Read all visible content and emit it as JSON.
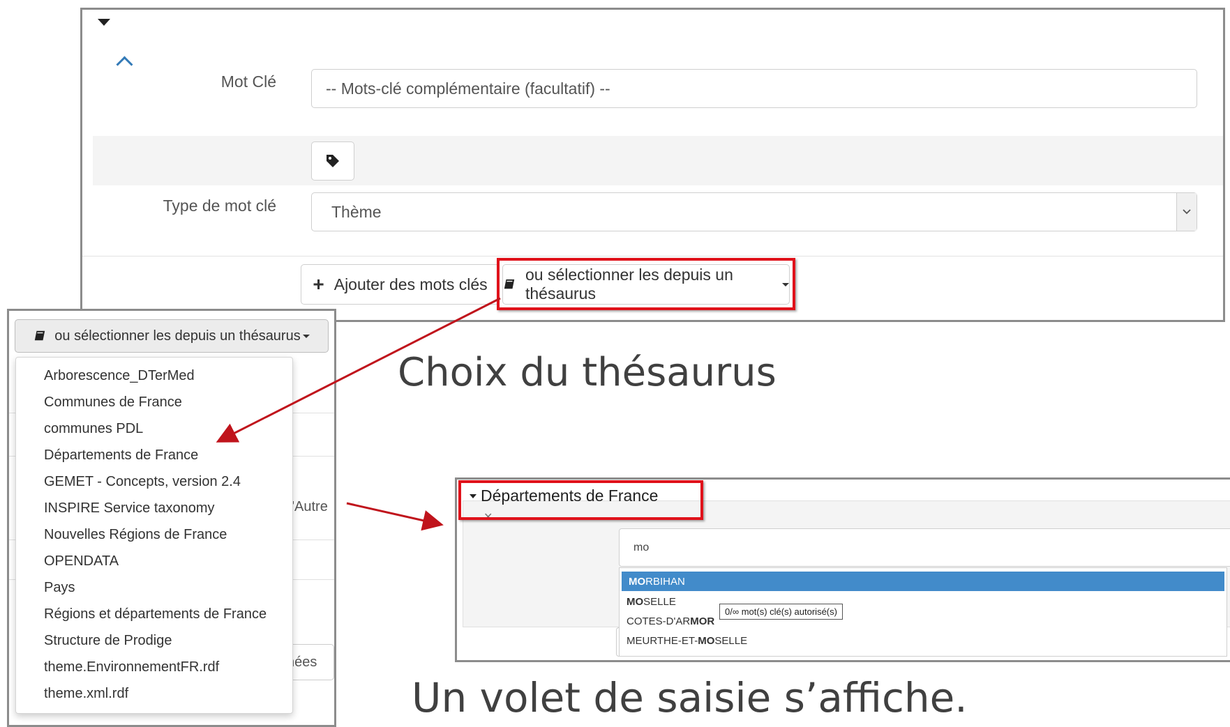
{
  "top_form": {
    "mot_cle_label": "Mot Clé",
    "mot_cle_placeholder": "-- Mots-clé complémentaire (facultatif) --",
    "type_label": "Type de mot clé",
    "type_value": "Thème",
    "add_button_label": "Ajouter des mots clés",
    "thesaurus_button_label": "ou sélectionner les depuis un thésaurus"
  },
  "dropdown": {
    "button_label": "ou sélectionner les depuis un thésaurus",
    "items": [
      "Arborescence_DTerMed",
      "Communes de France",
      "communes PDL",
      "Départements de France",
      "GEMET - Concepts, version 2.4",
      "INSPIRE Service taxonomy",
      "Nouvelles Régions de France",
      "OPENDATA",
      "Pays",
      "Régions et départements de France",
      "Structure de Prodige",
      "theme.EnvironnementFR.rdf",
      "theme.xml.rdf"
    ],
    "background_fragments": {
      "autre": "r 'Autre",
      "nees": "nées"
    }
  },
  "captions": {
    "choix": "Choix du thésaurus",
    "volet": "Un volet de saisie s’affiche."
  },
  "thesaurus_panel": {
    "title": "Départements de France",
    "search_value": "mo",
    "suggestions": [
      {
        "match": "MO",
        "rest": "RBIHAN",
        "pre": "",
        "selected": true
      },
      {
        "match": "MO",
        "rest": "SELLE",
        "pre": "",
        "selected": false
      },
      {
        "pre": "COTES-D'AR",
        "match": "MOR",
        "rest": "",
        "selected": false
      },
      {
        "pre": "MEURTHE-ET-",
        "match": "MO",
        "rest": "SELLE",
        "selected": false
      }
    ],
    "tooltip": "0/∞ mot(s) clé(s) autorisé(s)"
  },
  "colors": {
    "highlight_red": "#e0121b",
    "arrow_red": "#c0141c",
    "selected_blue": "#428bca",
    "link_blue": "#337ab7"
  }
}
